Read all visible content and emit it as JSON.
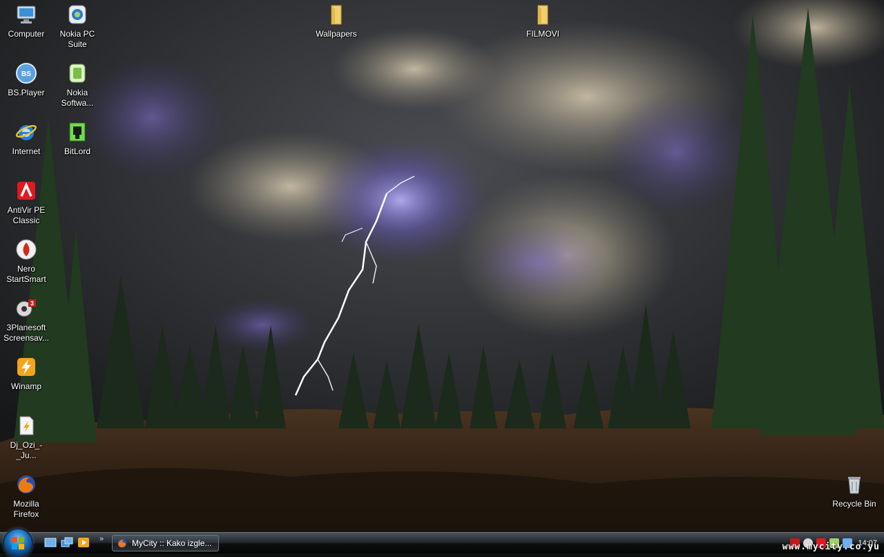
{
  "desktop": {
    "icons": [
      {
        "label": "Computer"
      },
      {
        "label": "Nokia PC\nSuite"
      },
      {
        "label": "BS.Player"
      },
      {
        "label": "Nokia\nSoftwa..."
      },
      {
        "label": "Internet"
      },
      {
        "label": "BitLord"
      },
      {
        "label": "AntiVir PE\nClassic"
      },
      {
        "label": "Nero\nStartSmart"
      },
      {
        "label": "3Planesoft\nScreensav..."
      },
      {
        "label": "Winamp"
      },
      {
        "label": "Dj_Ozi_-_Ju..."
      },
      {
        "label": "Mozilla\nFirefox"
      },
      {
        "label": "Wallpapers"
      },
      {
        "label": "FILMOVI"
      },
      {
        "label": "Recycle Bin"
      }
    ]
  },
  "taskbar": {
    "active_window": "MyCity :: Kako izgle...",
    "more_glyph": "»",
    "clock": "14:07"
  },
  "watermark": "www.mycity.co.yu",
  "colors": {
    "taskbar_dark": "#0b0d0f",
    "orb_blue": "#1a6bb8",
    "label_text": "#ffffff"
  }
}
